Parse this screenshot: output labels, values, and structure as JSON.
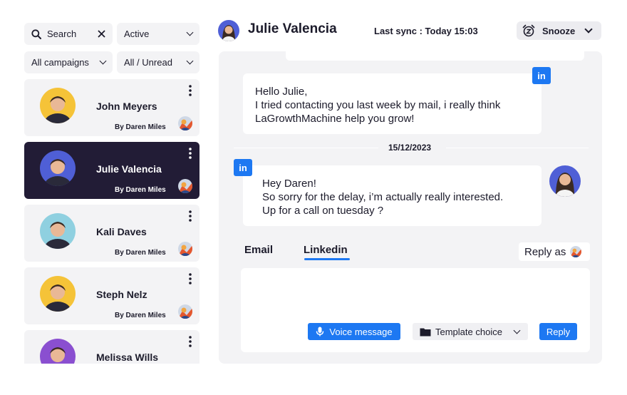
{
  "filters": {
    "search": {
      "label": "Search"
    },
    "status": {
      "selected": "Active"
    },
    "campaigns": {
      "selected": "All campaigns"
    },
    "read_state": {
      "selected": "All / Unread"
    }
  },
  "contacts": [
    {
      "name": "John Meyers",
      "by": "By Daren Miles",
      "active": false,
      "avatar_bg": "#f5c338"
    },
    {
      "name": "Julie Valencia",
      "by": "By Daren Miles",
      "active": true,
      "avatar_bg": "#4f5fd6"
    },
    {
      "name": "Kali Daves",
      "by": "By Daren Miles",
      "active": false,
      "avatar_bg": "#8fd0e0"
    },
    {
      "name": "Steph Nelz",
      "by": "By Daren Miles",
      "active": false,
      "avatar_bg": "#f5c338"
    },
    {
      "name": "Melissa Wills",
      "by": "",
      "active": false,
      "avatar_bg": "#8a4fd0"
    }
  ],
  "header": {
    "name": "Julie Valencia",
    "last_sync": "Last sync : Today 15:03",
    "snooze_label": "Snooze"
  },
  "messages": [
    {
      "sender": "outgoing",
      "channel_badge": "in",
      "lines": [
        "Hello Julie,",
        "I tried contacting you last week by mail, i really think",
        "LaGrowthMachine help you grow!"
      ]
    },
    {
      "sender": "incoming",
      "channel_badge": "in",
      "lines": [
        "Hey Daren!",
        "So sorry for the delay, i’m actually really interested.",
        "Up for a call on tuesday ?"
      ]
    }
  ],
  "date_separator": "15/12/2023",
  "tabs": [
    {
      "label": "Email",
      "selected": false
    },
    {
      "label": "Linkedin",
      "selected": true
    }
  ],
  "reply_as_label": "Reply as",
  "composer": {
    "voice_label": "Voice message",
    "template_label": "Template choice",
    "reply_label": "Reply"
  },
  "colors": {
    "accent": "#1d78f2",
    "active_card": "#221c36",
    "panel": "#f3f3f5"
  }
}
